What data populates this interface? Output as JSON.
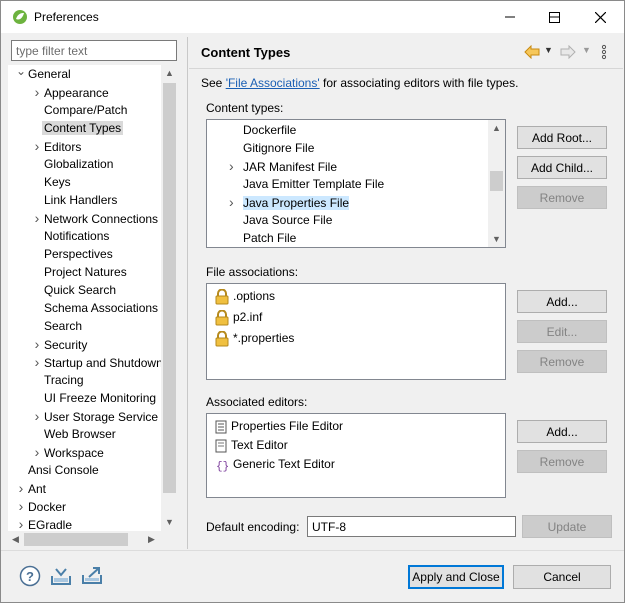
{
  "window": {
    "title": "Preferences",
    "minimize_icon": "minimize-icon",
    "maximize_icon": "maximize-icon",
    "close_icon": "close-icon"
  },
  "left": {
    "filter_placeholder": "type filter text",
    "tree": [
      {
        "label": "General",
        "expanded": true,
        "level": 0
      },
      {
        "label": "Appearance",
        "level": 1,
        "expandable": true
      },
      {
        "label": "Compare/Patch",
        "level": 1
      },
      {
        "label": "Content Types",
        "level": 1,
        "selected": true
      },
      {
        "label": "Editors",
        "level": 1,
        "expandable": true
      },
      {
        "label": "Globalization",
        "level": 1
      },
      {
        "label": "Keys",
        "level": 1
      },
      {
        "label": "Link Handlers",
        "level": 1
      },
      {
        "label": "Network Connections",
        "level": 1,
        "expandable": true
      },
      {
        "label": "Notifications",
        "level": 1
      },
      {
        "label": "Perspectives",
        "level": 1
      },
      {
        "label": "Project Natures",
        "level": 1
      },
      {
        "label": "Quick Search",
        "level": 1
      },
      {
        "label": "Schema Associations",
        "level": 1
      },
      {
        "label": "Search",
        "level": 1
      },
      {
        "label": "Security",
        "level": 1,
        "expandable": true
      },
      {
        "label": "Startup and Shutdown",
        "level": 1,
        "expandable": true
      },
      {
        "label": "Tracing",
        "level": 1
      },
      {
        "label": "UI Freeze Monitoring",
        "level": 1
      },
      {
        "label": "User Storage Service",
        "level": 1,
        "expandable": true
      },
      {
        "label": "Web Browser",
        "level": 1
      },
      {
        "label": "Workspace",
        "level": 1,
        "expandable": true
      },
      {
        "label": "Ansi Console",
        "level": 0
      },
      {
        "label": "Ant",
        "level": 0,
        "expandable": true
      },
      {
        "label": "Docker",
        "level": 0,
        "expandable": true
      },
      {
        "label": "EGradle",
        "level": 0,
        "expandable": true
      }
    ]
  },
  "right": {
    "page_title": "Content Types",
    "intro_prefix": "See ",
    "intro_link": "'File Associations'",
    "intro_suffix": " for associating editors with file types.",
    "content_types_label": "Content types:",
    "content_types": [
      {
        "label": "Dockerfile",
        "expandable": false
      },
      {
        "label": "Gitignore File",
        "expandable": false
      },
      {
        "label": "JAR Manifest File",
        "expandable": true
      },
      {
        "label": "Java Emitter Template File",
        "expandable": false
      },
      {
        "label": "Java Properties File",
        "expandable": true,
        "selected": true
      },
      {
        "label": "Java Source File",
        "expandable": false
      },
      {
        "label": "Patch File",
        "expandable": false
      }
    ],
    "content_buttons": {
      "add_root": "Add Root...",
      "add_child": "Add Child...",
      "remove": "Remove"
    },
    "file_assoc_label": "File associations:",
    "file_assocs": [
      ".options",
      "p2.inf",
      "*.properties"
    ],
    "file_assoc_buttons": {
      "add": "Add...",
      "edit": "Edit...",
      "remove": "Remove"
    },
    "editors_label": "Associated editors:",
    "editors": [
      {
        "label": "Properties File Editor",
        "icon": "properties-editor-icon"
      },
      {
        "label": "Text Editor",
        "icon": "text-editor-icon"
      },
      {
        "label": "Generic Text Editor",
        "icon": "generic-editor-icon"
      }
    ],
    "editor_buttons": {
      "add": "Add...",
      "remove": "Remove"
    },
    "encoding_label": "Default encoding:",
    "encoding_value": "UTF-8",
    "update_label": "Update"
  },
  "footer": {
    "apply_close": "Apply and Close",
    "cancel": "Cancel"
  },
  "colors": {
    "selection": "#cce8ff",
    "link": "#1a5fb4",
    "accent": "#0078d7"
  }
}
